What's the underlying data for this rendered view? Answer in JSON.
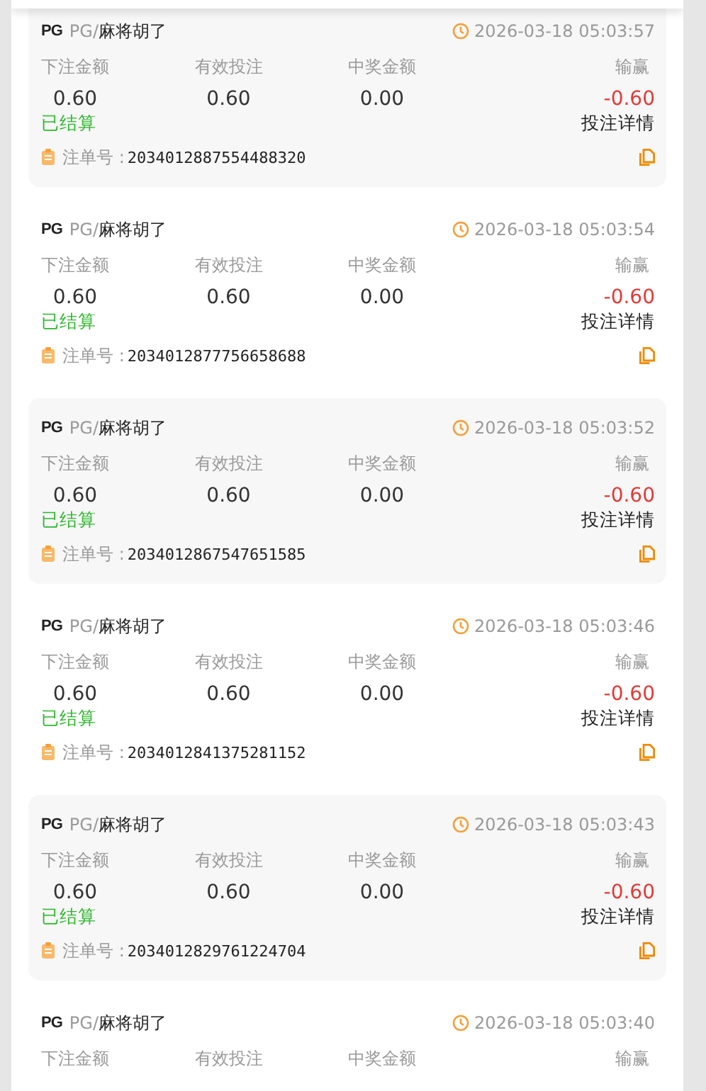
{
  "bets": [
    {
      "logo": "PG",
      "provider": "PG/",
      "game": "麻将胡了",
      "time": "2026-03-18 05:03:57",
      "columns": [
        {
          "label": "下注金额",
          "value": "0.60"
        },
        {
          "label": "有效投注",
          "value": "0.60"
        },
        {
          "label": "中奖金额",
          "value": "0.00"
        },
        {
          "label": "输赢",
          "value": "-0.60"
        }
      ],
      "status": "已结算",
      "detail_link": "投注详情",
      "order_label": "注单号 :",
      "order_no": "2034012887554488320"
    },
    {
      "logo": "PG",
      "provider": "PG/",
      "game": "麻将胡了",
      "time": "2026-03-18 05:03:54",
      "columns": [
        {
          "label": "下注金额",
          "value": "0.60"
        },
        {
          "label": "有效投注",
          "value": "0.60"
        },
        {
          "label": "中奖金额",
          "value": "0.00"
        },
        {
          "label": "输赢",
          "value": "-0.60"
        }
      ],
      "status": "已结算",
      "detail_link": "投注详情",
      "order_label": "注单号 :",
      "order_no": "2034012877756658688"
    },
    {
      "logo": "PG",
      "provider": "PG/",
      "game": "麻将胡了",
      "time": "2026-03-18 05:03:52",
      "columns": [
        {
          "label": "下注金额",
          "value": "0.60"
        },
        {
          "label": "有效投注",
          "value": "0.60"
        },
        {
          "label": "中奖金额",
          "value": "0.00"
        },
        {
          "label": "输赢",
          "value": "-0.60"
        }
      ],
      "status": "已结算",
      "detail_link": "投注详情",
      "order_label": "注单号 :",
      "order_no": "2034012867547651585"
    },
    {
      "logo": "PG",
      "provider": "PG/",
      "game": "麻将胡了",
      "time": "2026-03-18 05:03:46",
      "columns": [
        {
          "label": "下注金额",
          "value": "0.60"
        },
        {
          "label": "有效投注",
          "value": "0.60"
        },
        {
          "label": "中奖金额",
          "value": "0.00"
        },
        {
          "label": "输赢",
          "value": "-0.60"
        }
      ],
      "status": "已结算",
      "detail_link": "投注详情",
      "order_label": "注单号 :",
      "order_no": "2034012841375281152"
    },
    {
      "logo": "PG",
      "provider": "PG/",
      "game": "麻将胡了",
      "time": "2026-03-18 05:03:43",
      "columns": [
        {
          "label": "下注金额",
          "value": "0.60"
        },
        {
          "label": "有效投注",
          "value": "0.60"
        },
        {
          "label": "中奖金额",
          "value": "0.00"
        },
        {
          "label": "输赢",
          "value": "-0.60"
        }
      ],
      "status": "已结算",
      "detail_link": "投注详情",
      "order_label": "注单号 :",
      "order_no": "2034012829761224704"
    },
    {
      "logo": "PG",
      "provider": "PG/",
      "game": "麻将胡了",
      "time": "2026-03-18 05:03:40",
      "columns": [
        {
          "label": "下注金额"
        },
        {
          "label": "有效投注"
        },
        {
          "label": "中奖金额"
        },
        {
          "label": "输赢"
        }
      ]
    }
  ]
}
